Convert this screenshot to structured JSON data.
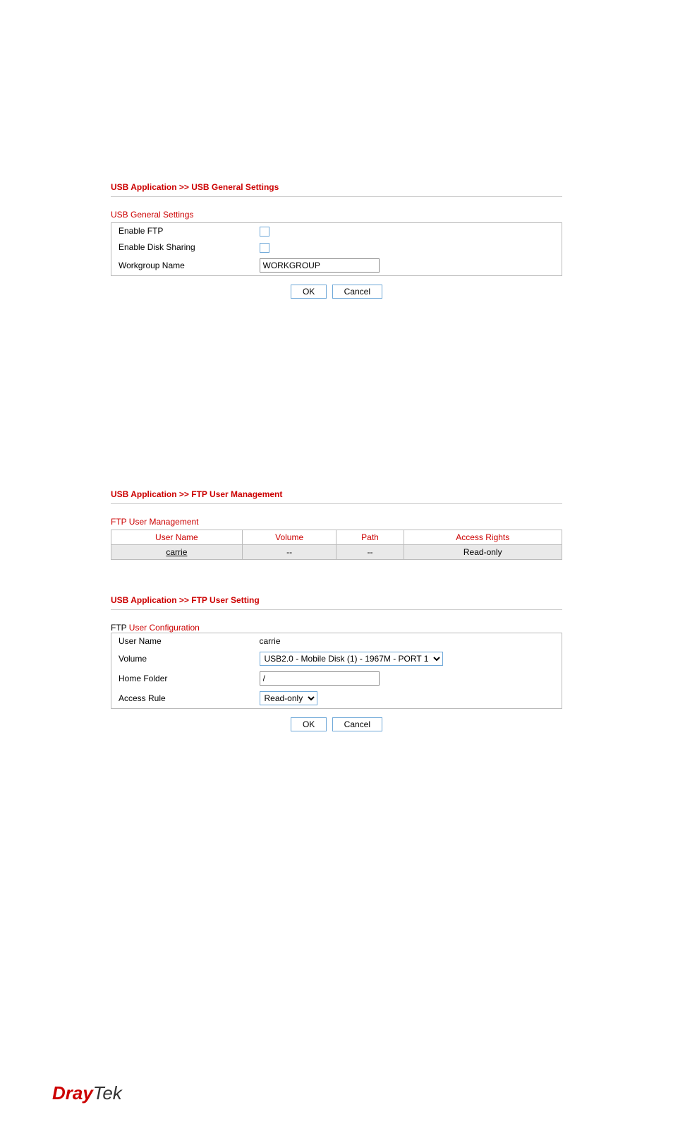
{
  "section1": {
    "breadcrumb": "USB Application >> USB General Settings",
    "subtitle": "USB General Settings",
    "rows": {
      "enableFtp": "Enable FTP",
      "enableDiskSharing": "Enable Disk Sharing",
      "workgroupName": "Workgroup Name",
      "workgroupValue": "WORKGROUP"
    },
    "okLabel": "OK",
    "cancelLabel": "Cancel"
  },
  "section2": {
    "breadcrumb": "USB Application >> FTP User Management",
    "subtitle": "FTP User Management",
    "headers": {
      "userName": "User Name",
      "volume": "Volume",
      "path": "Path",
      "accessRights": "Access Rights"
    },
    "row": {
      "userName": "carrie",
      "volume": "--",
      "path": "--",
      "accessRights": "Read-only"
    }
  },
  "section3": {
    "breadcrumb": "USB Application >> FTP User Setting",
    "titlePrefix": "FTP ",
    "titleRest": "User Configuration",
    "labels": {
      "userName": "User Name",
      "volume": "Volume",
      "homeFolder": "Home Folder",
      "accessRule": "Access Rule"
    },
    "values": {
      "userName": "carrie",
      "volumeOption": "USB2.0   - Mobile Disk      (1) - 1967M - PORT 1",
      "homeFolder": "/",
      "accessRuleOption": "Read-only"
    },
    "okLabel": "OK",
    "cancelLabel": "Cancel"
  },
  "logo": {
    "dray": "Dray",
    "tek": "Tek"
  }
}
